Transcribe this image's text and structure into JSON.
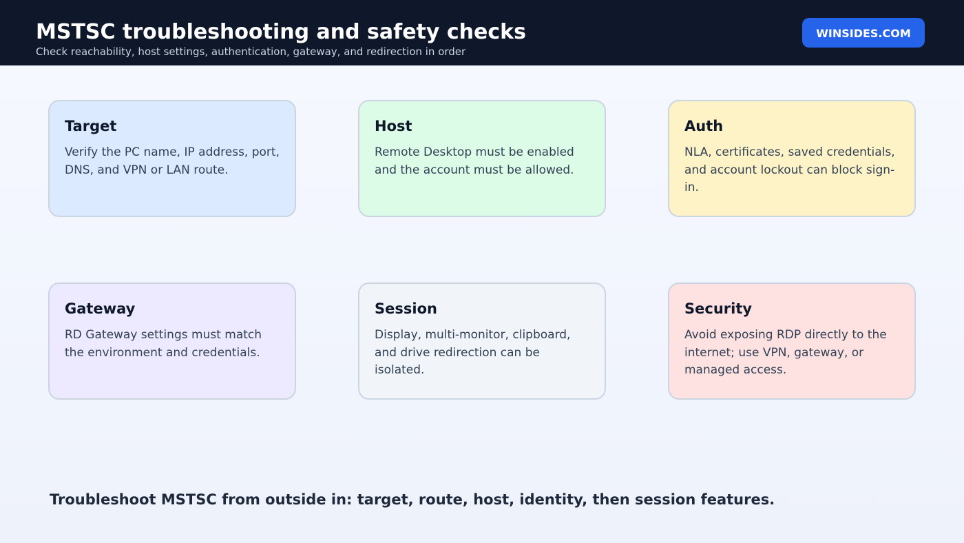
{
  "header": {
    "title": "MSTSC troubleshooting and safety checks",
    "subtitle": "Check reachability, host settings, authentication, gateway, and redirection in order",
    "brand": "WINSIDES.COM"
  },
  "cards": [
    {
      "title": "Target",
      "body": "Verify the PC name, IP address, port, DNS, and VPN or LAN route.",
      "color": "#dbeafe"
    },
    {
      "title": "Host",
      "body": "Remote Desktop must be enabled and the account must be allowed.",
      "color": "#dcfce7"
    },
    {
      "title": "Auth",
      "body": "NLA, certificates, saved credentials, and account lockout can block sign-in.",
      "color": "#fef3c7"
    },
    {
      "title": "Gateway",
      "body": "RD Gateway settings must match the environment and credentials.",
      "color": "#ede9fe"
    },
    {
      "title": "Session",
      "body": "Display, multi-monitor, clipboard, and drive redirection can be isolated.",
      "color": "#f1f5f9"
    },
    {
      "title": "Security",
      "body": "Avoid exposing RDP directly to the internet; use VPN, gateway, or managed access.",
      "color": "#fee2e2"
    }
  ],
  "footer": {
    "note": "Troubleshoot MSTSC from outside in: target, route, host, identity, then session features."
  },
  "colors": {
    "header_bg": "#0f172a",
    "brand_bg": "#2563eb",
    "card_border": "#cbd5e1"
  }
}
